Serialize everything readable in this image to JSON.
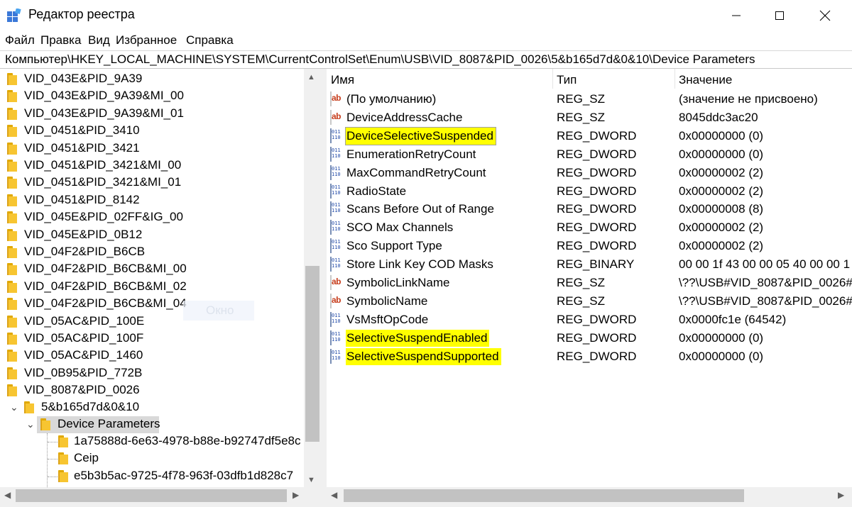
{
  "window": {
    "title": "Редактор реестра",
    "icons": {
      "app": "regedit-icon",
      "minimize": "minimize-icon",
      "maximize": "maximize-icon",
      "close": "close-icon"
    }
  },
  "menu": [
    "Файл",
    "Правка",
    "Вид",
    "Избранное",
    "Справка"
  ],
  "address": "Компьютер\\HKEY_LOCAL_MACHINE\\SYSTEM\\CurrentControlSet\\Enum\\USB\\VID_8087&PID_0026\\5&b165d7d&0&10\\Device Parameters",
  "tree": {
    "items": [
      "VID_043E&PID_9A39",
      "VID_043E&PID_9A39&MI_00",
      "VID_043E&PID_9A39&MI_01",
      "VID_0451&PID_3410",
      "VID_0451&PID_3421",
      "VID_0451&PID_3421&MI_00",
      "VID_0451&PID_3421&MI_01",
      "VID_0451&PID_8142",
      "VID_045E&PID_02FF&IG_00",
      "VID_045E&PID_0B12",
      "VID_04F2&PID_B6CB",
      "VID_04F2&PID_B6CB&MI_00",
      "VID_04F2&PID_B6CB&MI_02",
      "VID_04F2&PID_B6CB&MI_04",
      "VID_05AC&PID_100E",
      "VID_05AC&PID_100F",
      "VID_05AC&PID_1460",
      "VID_0B95&PID_772B",
      "VID_8087&PID_0026"
    ],
    "expanded_key": "5&b165d7d&0&10",
    "selected_key": "Device Parameters",
    "children": [
      "1a75888d-6e63-4978-b88e-b92747df5e8c",
      "Ceip",
      "e5b3b5ac-9725-4f78-963f-03dfb1d828c7"
    ],
    "ghost_label": "Окно"
  },
  "columns": {
    "name": "Имя",
    "type": "Тип",
    "data": "Значение"
  },
  "values": [
    {
      "name": "(По умолчанию)",
      "type": "REG_SZ",
      "data": "(значение не присвоено)",
      "icon": "string-value-icon",
      "highlight": false
    },
    {
      "name": "DeviceAddressCache",
      "type": "REG_SZ",
      "data": "8045ddc3ac20",
      "icon": "string-value-icon",
      "highlight": false
    },
    {
      "name": "DeviceSelectiveSuspended",
      "type": "REG_DWORD",
      "data": "0x00000000 (0)",
      "icon": "binary-value-icon",
      "highlight": true
    },
    {
      "name": "EnumerationRetryCount",
      "type": "REG_DWORD",
      "data": "0x00000000 (0)",
      "icon": "binary-value-icon",
      "highlight": false
    },
    {
      "name": "MaxCommandRetryCount",
      "type": "REG_DWORD",
      "data": "0x00000002 (2)",
      "icon": "binary-value-icon",
      "highlight": false
    },
    {
      "name": "RadioState",
      "type": "REG_DWORD",
      "data": "0x00000002 (2)",
      "icon": "binary-value-icon",
      "highlight": false
    },
    {
      "name": "Scans Before Out of Range",
      "type": "REG_DWORD",
      "data": "0x00000008 (8)",
      "icon": "binary-value-icon",
      "highlight": false
    },
    {
      "name": "SCO Max Channels",
      "type": "REG_DWORD",
      "data": "0x00000002 (2)",
      "icon": "binary-value-icon",
      "highlight": false
    },
    {
      "name": "Sco Support Type",
      "type": "REG_DWORD",
      "data": "0x00000002 (2)",
      "icon": "binary-value-icon",
      "highlight": false
    },
    {
      "name": "Store Link Key COD Masks",
      "type": "REG_BINARY",
      "data": "00 00 1f 43 00 00 05 40 00 00 1",
      "icon": "binary-value-icon",
      "highlight": false
    },
    {
      "name": "SymbolicLinkName",
      "type": "REG_SZ",
      "data": "\\??\\USB#VID_8087&PID_0026#5",
      "icon": "string-value-icon",
      "highlight": false
    },
    {
      "name": "SymbolicName",
      "type": "REG_SZ",
      "data": "\\??\\USB#VID_8087&PID_0026#5",
      "icon": "string-value-icon",
      "highlight": false
    },
    {
      "name": "VsMsftOpCode",
      "type": "REG_DWORD",
      "data": "0x0000fc1e (64542)",
      "icon": "binary-value-icon",
      "highlight": false
    },
    {
      "name": "SelectiveSuspendEnabled",
      "type": "REG_DWORD",
      "data": "0x00000000 (0)",
      "icon": "binary-value-icon",
      "highlight": true
    },
    {
      "name": "SelectiveSuspendSupported",
      "type": "REG_DWORD",
      "data": "0x00000000 (0)",
      "icon": "binary-value-icon",
      "highlight": true
    }
  ],
  "colors": {
    "highlight": "#ffff00",
    "selection": "#d9d9d9",
    "folder": "#f7c531"
  }
}
